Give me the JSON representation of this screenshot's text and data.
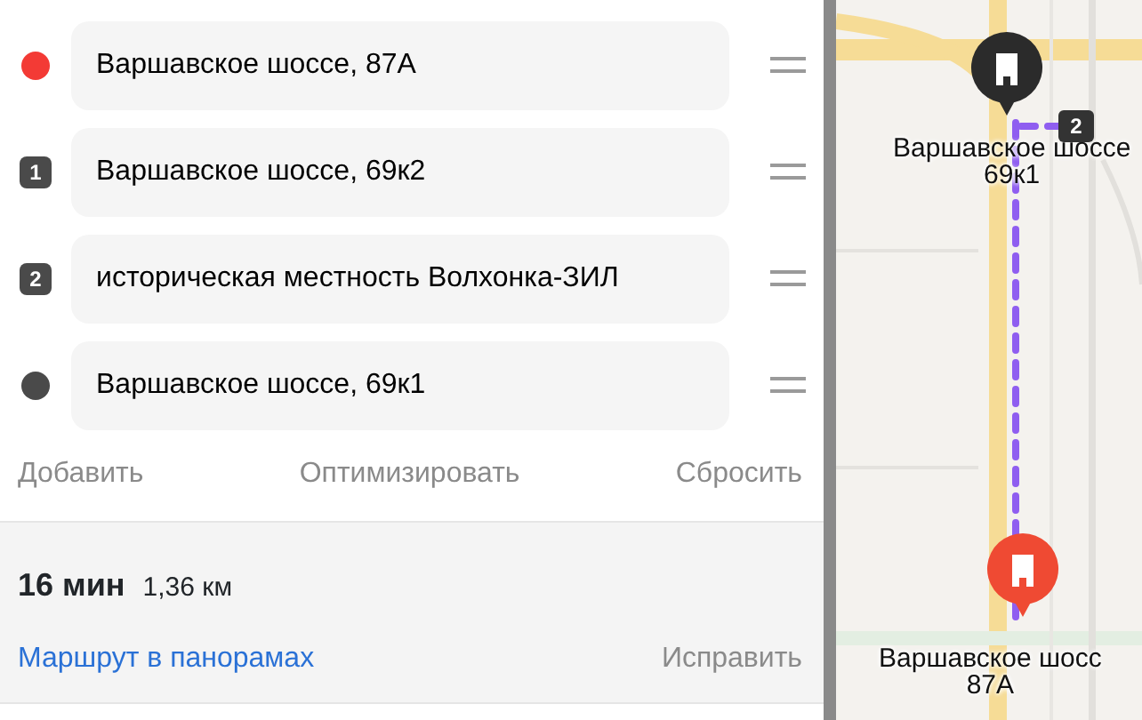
{
  "waypoints": [
    {
      "kind": "dot",
      "color": "#f33a35",
      "address": "Варшавское шоссе, 87А"
    },
    {
      "kind": "number",
      "number": "1",
      "address": "Варшавское шоссе, 69к2"
    },
    {
      "kind": "number",
      "number": "2",
      "address": "историческая местность Волхонка-ЗИЛ"
    },
    {
      "kind": "dot",
      "color": "#4a4a4a",
      "address": "Варшавское шоссе, 69к1"
    }
  ],
  "actions": [
    "Добавить",
    "Оптимизировать",
    "Сбросить"
  ],
  "summary": {
    "time": "16 мин",
    "distance": "1,36 км",
    "panorama_link": "Маршрут в панорамах",
    "fix": "Исправить"
  },
  "map": {
    "pins": [
      {
        "kind": "dark",
        "label": [
          "Варшавское шоссе",
          "69к1"
        ],
        "badge": "2"
      },
      {
        "kind": "red",
        "label": [
          "Варшавское шосс",
          "87А"
        ]
      }
    ]
  }
}
